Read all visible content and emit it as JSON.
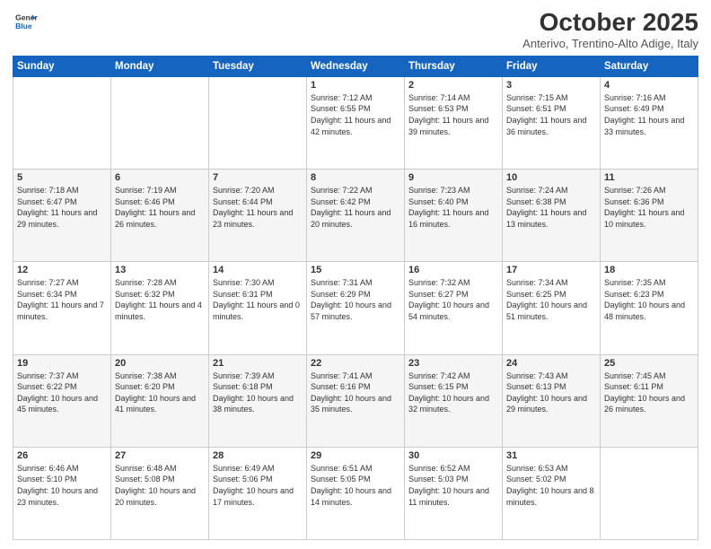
{
  "logo": {
    "line1": "General",
    "line2": "Blue"
  },
  "title": "October 2025",
  "subtitle": "Anterivo, Trentino-Alto Adige, Italy",
  "weekdays": [
    "Sunday",
    "Monday",
    "Tuesday",
    "Wednesday",
    "Thursday",
    "Friday",
    "Saturday"
  ],
  "weeks": [
    [
      {
        "day": "",
        "info": ""
      },
      {
        "day": "",
        "info": ""
      },
      {
        "day": "",
        "info": ""
      },
      {
        "day": "1",
        "info": "Sunrise: 7:12 AM\nSunset: 6:55 PM\nDaylight: 11 hours and 42 minutes."
      },
      {
        "day": "2",
        "info": "Sunrise: 7:14 AM\nSunset: 6:53 PM\nDaylight: 11 hours and 39 minutes."
      },
      {
        "day": "3",
        "info": "Sunrise: 7:15 AM\nSunset: 6:51 PM\nDaylight: 11 hours and 36 minutes."
      },
      {
        "day": "4",
        "info": "Sunrise: 7:16 AM\nSunset: 6:49 PM\nDaylight: 11 hours and 33 minutes."
      }
    ],
    [
      {
        "day": "5",
        "info": "Sunrise: 7:18 AM\nSunset: 6:47 PM\nDaylight: 11 hours and 29 minutes."
      },
      {
        "day": "6",
        "info": "Sunrise: 7:19 AM\nSunset: 6:46 PM\nDaylight: 11 hours and 26 minutes."
      },
      {
        "day": "7",
        "info": "Sunrise: 7:20 AM\nSunset: 6:44 PM\nDaylight: 11 hours and 23 minutes."
      },
      {
        "day": "8",
        "info": "Sunrise: 7:22 AM\nSunset: 6:42 PM\nDaylight: 11 hours and 20 minutes."
      },
      {
        "day": "9",
        "info": "Sunrise: 7:23 AM\nSunset: 6:40 PM\nDaylight: 11 hours and 16 minutes."
      },
      {
        "day": "10",
        "info": "Sunrise: 7:24 AM\nSunset: 6:38 PM\nDaylight: 11 hours and 13 minutes."
      },
      {
        "day": "11",
        "info": "Sunrise: 7:26 AM\nSunset: 6:36 PM\nDaylight: 11 hours and 10 minutes."
      }
    ],
    [
      {
        "day": "12",
        "info": "Sunrise: 7:27 AM\nSunset: 6:34 PM\nDaylight: 11 hours and 7 minutes."
      },
      {
        "day": "13",
        "info": "Sunrise: 7:28 AM\nSunset: 6:32 PM\nDaylight: 11 hours and 4 minutes."
      },
      {
        "day": "14",
        "info": "Sunrise: 7:30 AM\nSunset: 6:31 PM\nDaylight: 11 hours and 0 minutes."
      },
      {
        "day": "15",
        "info": "Sunrise: 7:31 AM\nSunset: 6:29 PM\nDaylight: 10 hours and 57 minutes."
      },
      {
        "day": "16",
        "info": "Sunrise: 7:32 AM\nSunset: 6:27 PM\nDaylight: 10 hours and 54 minutes."
      },
      {
        "day": "17",
        "info": "Sunrise: 7:34 AM\nSunset: 6:25 PM\nDaylight: 10 hours and 51 minutes."
      },
      {
        "day": "18",
        "info": "Sunrise: 7:35 AM\nSunset: 6:23 PM\nDaylight: 10 hours and 48 minutes."
      }
    ],
    [
      {
        "day": "19",
        "info": "Sunrise: 7:37 AM\nSunset: 6:22 PM\nDaylight: 10 hours and 45 minutes."
      },
      {
        "day": "20",
        "info": "Sunrise: 7:38 AM\nSunset: 6:20 PM\nDaylight: 10 hours and 41 minutes."
      },
      {
        "day": "21",
        "info": "Sunrise: 7:39 AM\nSunset: 6:18 PM\nDaylight: 10 hours and 38 minutes."
      },
      {
        "day": "22",
        "info": "Sunrise: 7:41 AM\nSunset: 6:16 PM\nDaylight: 10 hours and 35 minutes."
      },
      {
        "day": "23",
        "info": "Sunrise: 7:42 AM\nSunset: 6:15 PM\nDaylight: 10 hours and 32 minutes."
      },
      {
        "day": "24",
        "info": "Sunrise: 7:43 AM\nSunset: 6:13 PM\nDaylight: 10 hours and 29 minutes."
      },
      {
        "day": "25",
        "info": "Sunrise: 7:45 AM\nSunset: 6:11 PM\nDaylight: 10 hours and 26 minutes."
      }
    ],
    [
      {
        "day": "26",
        "info": "Sunrise: 6:46 AM\nSunset: 5:10 PM\nDaylight: 10 hours and 23 minutes."
      },
      {
        "day": "27",
        "info": "Sunrise: 6:48 AM\nSunset: 5:08 PM\nDaylight: 10 hours and 20 minutes."
      },
      {
        "day": "28",
        "info": "Sunrise: 6:49 AM\nSunset: 5:06 PM\nDaylight: 10 hours and 17 minutes."
      },
      {
        "day": "29",
        "info": "Sunrise: 6:51 AM\nSunset: 5:05 PM\nDaylight: 10 hours and 14 minutes."
      },
      {
        "day": "30",
        "info": "Sunrise: 6:52 AM\nSunset: 5:03 PM\nDaylight: 10 hours and 11 minutes."
      },
      {
        "day": "31",
        "info": "Sunrise: 6:53 AM\nSunset: 5:02 PM\nDaylight: 10 hours and 8 minutes."
      },
      {
        "day": "",
        "info": ""
      }
    ]
  ]
}
